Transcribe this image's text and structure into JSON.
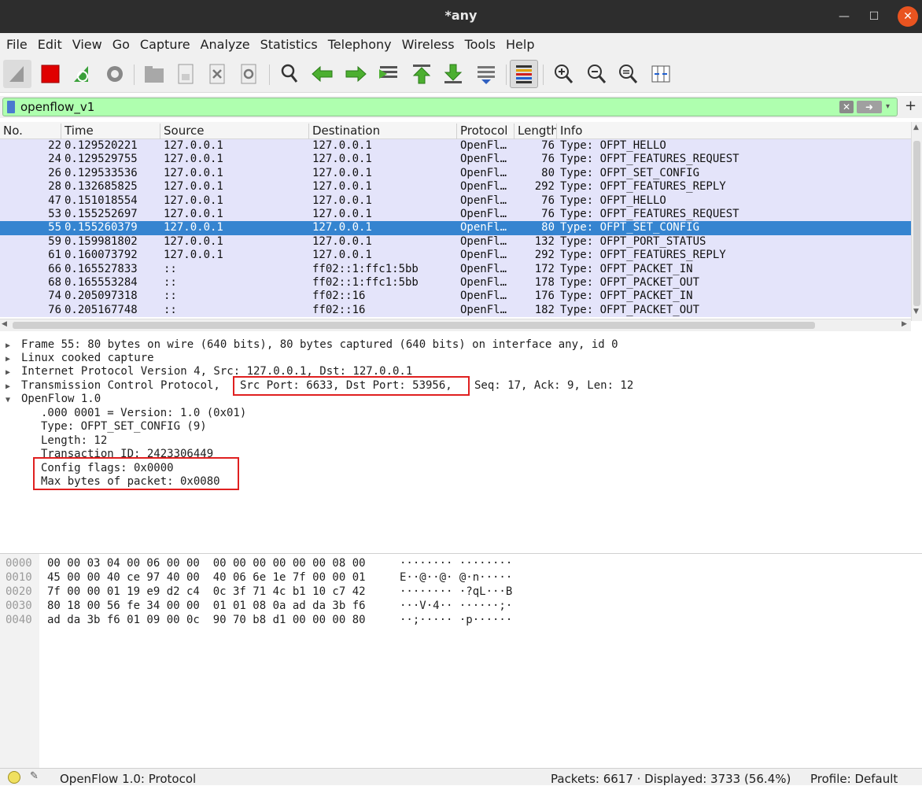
{
  "window": {
    "title": "*any"
  },
  "menu": [
    "File",
    "Edit",
    "View",
    "Go",
    "Capture",
    "Analyze",
    "Statistics",
    "Telephony",
    "Wireless",
    "Tools",
    "Help"
  ],
  "filter": {
    "value": "openflow_v1"
  },
  "packet_list": {
    "columns": [
      "No.",
      "Time",
      "Source",
      "Destination",
      "Protocol",
      "Length",
      "Info"
    ],
    "rows": [
      {
        "no": "22",
        "time": "0.129520221",
        "src": "127.0.0.1",
        "dst": "127.0.0.1",
        "proto": "OpenFl…",
        "len": "76",
        "info": "Type: OFPT_HELLO"
      },
      {
        "no": "24",
        "time": "0.129529755",
        "src": "127.0.0.1",
        "dst": "127.0.0.1",
        "proto": "OpenFl…",
        "len": "76",
        "info": "Type: OFPT_FEATURES_REQUEST"
      },
      {
        "no": "26",
        "time": "0.129533536",
        "src": "127.0.0.1",
        "dst": "127.0.0.1",
        "proto": "OpenFl…",
        "len": "80",
        "info": "Type: OFPT_SET_CONFIG"
      },
      {
        "no": "28",
        "time": "0.132685825",
        "src": "127.0.0.1",
        "dst": "127.0.0.1",
        "proto": "OpenFl…",
        "len": "292",
        "info": "Type: OFPT_FEATURES_REPLY"
      },
      {
        "no": "47",
        "time": "0.151018554",
        "src": "127.0.0.1",
        "dst": "127.0.0.1",
        "proto": "OpenFl…",
        "len": "76",
        "info": "Type: OFPT_HELLO"
      },
      {
        "no": "53",
        "time": "0.155252697",
        "src": "127.0.0.1",
        "dst": "127.0.0.1",
        "proto": "OpenFl…",
        "len": "76",
        "info": "Type: OFPT_FEATURES_REQUEST"
      },
      {
        "no": "55",
        "time": "0.155260379",
        "src": "127.0.0.1",
        "dst": "127.0.0.1",
        "proto": "OpenFl…",
        "len": "80",
        "info": "Type: OFPT_SET_CONFIG"
      },
      {
        "no": "59",
        "time": "0.159981802",
        "src": "127.0.0.1",
        "dst": "127.0.0.1",
        "proto": "OpenFl…",
        "len": "132",
        "info": "Type: OFPT_PORT_STATUS"
      },
      {
        "no": "61",
        "time": "0.160073792",
        "src": "127.0.0.1",
        "dst": "127.0.0.1",
        "proto": "OpenFl…",
        "len": "292",
        "info": "Type: OFPT_FEATURES_REPLY"
      },
      {
        "no": "66",
        "time": "0.165527833",
        "src": "::",
        "dst": "ff02::1:ffc1:5bb",
        "proto": "OpenFl…",
        "len": "172",
        "info": "Type: OFPT_PACKET_IN"
      },
      {
        "no": "68",
        "time": "0.165553284",
        "src": "::",
        "dst": "ff02::1:ffc1:5bb",
        "proto": "OpenFl…",
        "len": "178",
        "info": "Type: OFPT_PACKET_OUT"
      },
      {
        "no": "74",
        "time": "0.205097318",
        "src": "::",
        "dst": "ff02::16",
        "proto": "OpenFl…",
        "len": "176",
        "info": "Type: OFPT_PACKET_IN"
      },
      {
        "no": "76",
        "time": "0.205167748",
        "src": "::",
        "dst": "ff02::16",
        "proto": "OpenFl…",
        "len": "182",
        "info": "Type: OFPT_PACKET_OUT"
      }
    ]
  },
  "details": {
    "frame": "Frame 55: 80 bytes on wire (640 bits), 80 bytes captured (640 bits) on interface any, id 0",
    "linux": "Linux cooked capture",
    "ip": "Internet Protocol Version 4, Src: 127.0.0.1, Dst: 127.0.0.1",
    "tcp_a": "Transmission Control Protocol,",
    "tcp_b": "Src Port: 6633, Dst Port: 53956,",
    "tcp_c": "Seq: 17, Ack: 9, Len: 12",
    "of": "OpenFlow 1.0",
    "of_version": ".000 0001 = Version: 1.0 (0x01)",
    "of_type": "Type: OFPT_SET_CONFIG (9)",
    "of_length": "Length: 12",
    "of_xid": "Transaction ID: 2423306449",
    "of_flags": "Config flags: 0x0000",
    "of_maxbytes": "Max bytes of packet: 0x0080"
  },
  "bytes": [
    {
      "off": "0000",
      "hex": "00 00 03 04 00 06 00 00  00 00 00 00 00 00 08 00",
      "ascii": "········ ········"
    },
    {
      "off": "0010",
      "hex": "45 00 00 40 ce 97 40 00  40 06 6e 1e 7f 00 00 01",
      "ascii": "E··@··@· @·n·····"
    },
    {
      "off": "0020",
      "hex": "7f 00 00 01 19 e9 d2 c4  0c 3f 71 4c b1 10 c7 42",
      "ascii": "········ ·?qL···B"
    },
    {
      "off": "0030",
      "hex": "80 18 00 56 fe 34 00 00  01 01 08 0a ad da 3b f6",
      "ascii": "···V·4·· ······;·"
    },
    {
      "off": "0040",
      "hex": "ad da 3b f6 01 09 00 0c  90 70 b8 d1 00 00 00 80",
      "ascii": "··;····· ·p······"
    }
  ],
  "status": {
    "left": "OpenFlow 1.0: Protocol",
    "packets": "Packets: 6617 · Displayed: 3733 (56.4%)",
    "profile": "Profile: Default"
  }
}
